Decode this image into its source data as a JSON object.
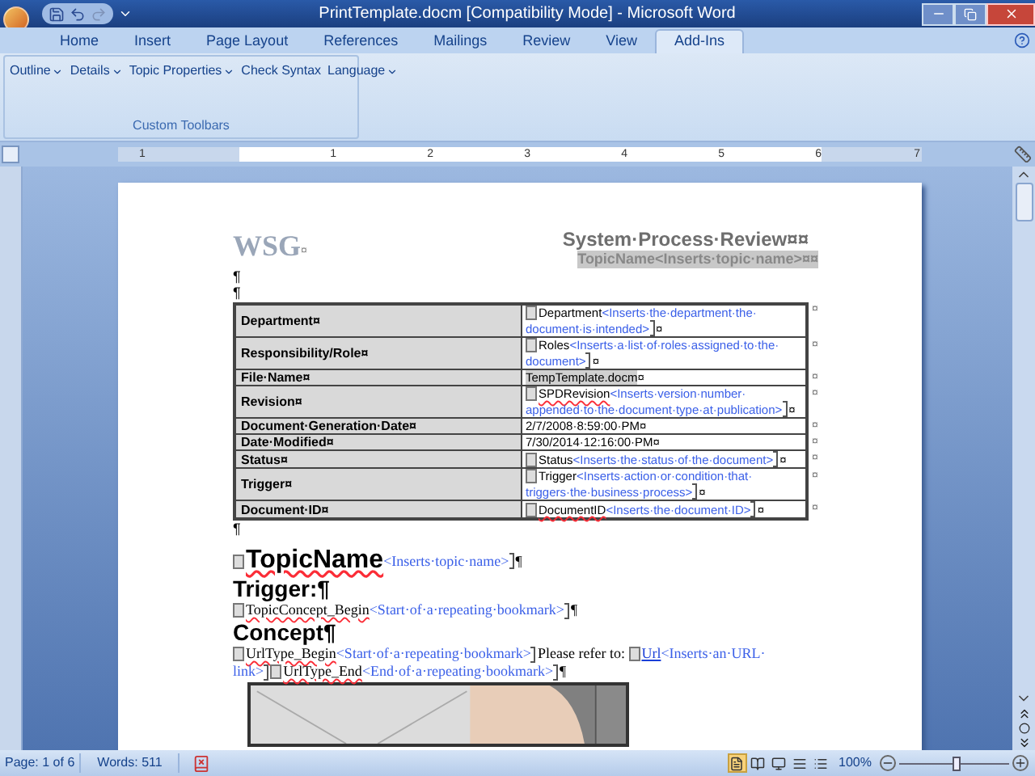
{
  "window": {
    "title": "PrintTemplate.docm [Compatibility Mode] - Microsoft Word"
  },
  "tabs": [
    {
      "label": "Home",
      "selected": false
    },
    {
      "label": "Insert",
      "selected": false
    },
    {
      "label": "Page Layout",
      "selected": false
    },
    {
      "label": "References",
      "selected": false
    },
    {
      "label": "Mailings",
      "selected": false
    },
    {
      "label": "Review",
      "selected": false
    },
    {
      "label": "View",
      "selected": false
    },
    {
      "label": "Add-Ins",
      "selected": true
    }
  ],
  "ribbon": {
    "items": [
      {
        "label": "Outline",
        "dropdown": true
      },
      {
        "label": "Details",
        "dropdown": true
      },
      {
        "label": "Topic Properties",
        "dropdown": true
      },
      {
        "label": "Check Syntax",
        "dropdown": false
      },
      {
        "label": "Language",
        "dropdown": true
      }
    ],
    "group_label": "Custom Toolbars"
  },
  "ruler": {
    "left_numbers": [
      "1"
    ],
    "numbers": [
      "1",
      "2",
      "3",
      "4",
      "5",
      "6",
      "7"
    ]
  },
  "document": {
    "logo": "WSG",
    "logo_mark": "¤",
    "title": "System·Process·Review¤¤",
    "subtitle": "TopicName<Inserts·topic·name>¤¤",
    "paragraph_marks": [
      "¶",
      "¶"
    ],
    "table": [
      {
        "label": "Department¤",
        "end": "¤",
        "runs": [
          {
            "kind": "open"
          },
          {
            "kind": "field",
            "text": "Department",
            "misspelled": false
          },
          {
            "kind": "hint",
            "text": "<Inserts·the·department·the·"
          },
          {
            "kind": "hint",
            "text": "document·is·intended>"
          },
          {
            "kind": "close"
          },
          {
            "kind": "text",
            "text": "¤"
          }
        ]
      },
      {
        "label": "Responsibility/Role¤",
        "end": "¤",
        "runs": [
          {
            "kind": "open"
          },
          {
            "kind": "field",
            "text": "Roles",
            "misspelled": false
          },
          {
            "kind": "hint",
            "text": "<Inserts·a·list·of·roles·assigned·to·the·"
          },
          {
            "kind": "hint",
            "text": "document>"
          },
          {
            "kind": "close"
          },
          {
            "kind": "text",
            "text": "¤"
          }
        ]
      },
      {
        "label": "File·Name¤",
        "end": "¤",
        "runs": [
          {
            "kind": "shaded",
            "text": "TempTemplate.docm"
          },
          {
            "kind": "text",
            "text": "¤"
          }
        ]
      },
      {
        "label": "Revision¤",
        "end": "¤",
        "runs": [
          {
            "kind": "open"
          },
          {
            "kind": "field",
            "text": "SPDRevision",
            "misspelled": true
          },
          {
            "kind": "hint",
            "text": "<Inserts·version·number·"
          },
          {
            "kind": "hint",
            "text": "appended·to·the·document·type·at·"
          },
          {
            "kind": "hint",
            "text": "publication>"
          },
          {
            "kind": "close"
          },
          {
            "kind": "text",
            "text": "¤"
          }
        ]
      },
      {
        "label": "Document·Generation·Date¤",
        "end": "¤",
        "runs": [
          {
            "kind": "text",
            "text": "2/7/2008·8:59:00·PM¤"
          }
        ]
      },
      {
        "label": "Date·Modified¤",
        "end": "¤",
        "runs": [
          {
            "kind": "text",
            "text": "7/30/2014·12:16:00·PM¤"
          }
        ]
      },
      {
        "label": "Status¤",
        "end": "¤",
        "runs": [
          {
            "kind": "open"
          },
          {
            "kind": "field",
            "text": "Status",
            "misspelled": false
          },
          {
            "kind": "hint",
            "text": "<Inserts·the·status·of·the·document>"
          },
          {
            "kind": "close"
          },
          {
            "kind": "text",
            "text": "¤"
          }
        ]
      },
      {
        "label": "Trigger¤",
        "end": "¤",
        "runs": [
          {
            "kind": "open"
          },
          {
            "kind": "field",
            "text": "Trigger",
            "misspelled": false
          },
          {
            "kind": "hint",
            "text": "<Inserts·action·or·condition·that·"
          },
          {
            "kind": "hint",
            "text": "triggers·the·business·process>"
          },
          {
            "kind": "close"
          },
          {
            "kind": "text",
            "text": "¤"
          }
        ]
      },
      {
        "label": "Document·ID¤",
        "end": "¤",
        "runs": [
          {
            "kind": "open"
          },
          {
            "kind": "field",
            "text": "DocumentID",
            "misspelled": true
          },
          {
            "kind": "hint",
            "text": "<Inserts·the·document·ID>"
          },
          {
            "kind": "close"
          },
          {
            "kind": "text",
            "text": "¤"
          }
        ]
      }
    ],
    "after_table": "¶",
    "lines": [
      {
        "kind": "topic",
        "runs": [
          {
            "kind": "open"
          },
          {
            "kind": "field",
            "text": "TopicName",
            "misspelled": true
          },
          {
            "kind": "hint",
            "text": "<Inserts·topic·name>"
          },
          {
            "kind": "close"
          },
          {
            "kind": "text",
            "text": "¶"
          }
        ]
      },
      {
        "kind": "heading",
        "runs": [
          {
            "kind": "text",
            "text": "Trigger:¶"
          }
        ]
      },
      {
        "kind": "body",
        "runs": [
          {
            "kind": "open"
          },
          {
            "kind": "field",
            "text": "TopicConcept_Begin",
            "misspelled": true
          },
          {
            "kind": "hint",
            "text": "<Start·of·a·repeating·bookmark>"
          },
          {
            "kind": "close"
          },
          {
            "kind": "text",
            "text": "¶"
          }
        ]
      },
      {
        "kind": "heading",
        "runs": [
          {
            "kind": "text",
            "text": "Concept¶"
          }
        ]
      },
      {
        "kind": "body",
        "runs": [
          {
            "kind": "open"
          },
          {
            "kind": "field",
            "text": "UrlType_Begin",
            "misspelled": true
          },
          {
            "kind": "hint",
            "text": "<Start·of·a·repeating·bookmark>"
          },
          {
            "kind": "close"
          },
          {
            "kind": "text",
            "text": "Please refer to: "
          },
          {
            "kind": "open"
          },
          {
            "kind": "link",
            "text": "Url"
          },
          {
            "kind": "hint",
            "text": "<Inserts·an·URL·"
          },
          {
            "kind": "hint",
            "text": "link>"
          },
          {
            "kind": "close"
          },
          {
            "kind": "open"
          },
          {
            "kind": "field",
            "text": "UrlType_End",
            "misspelled": true
          },
          {
            "kind": "hint",
            "text": "<End·of·a·repeating·bookmark>"
          },
          {
            "kind": "close"
          },
          {
            "kind": "text",
            "text": "¶"
          }
        ]
      }
    ]
  },
  "status_bar": {
    "page": "Page: 1 of 6",
    "words": "Words: 511",
    "views": [
      {
        "selected": true
      },
      {
        "selected": false
      },
      {
        "selected": false
      },
      {
        "selected": false
      },
      {
        "selected": false
      }
    ],
    "zoom": "100%",
    "zoom_slider": {
      "level": 0.53
    }
  }
}
